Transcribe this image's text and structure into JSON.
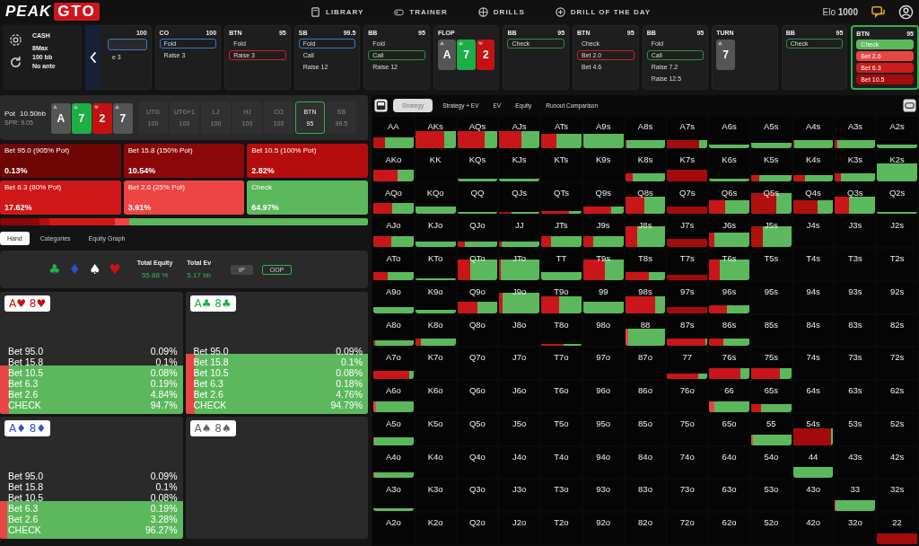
{
  "nav": {
    "logo": {
      "text": "PEAK",
      "highlight": "GTO"
    },
    "items": [
      {
        "label": "LIBRARY"
      },
      {
        "label": "TRAINER"
      },
      {
        "label": "DRILLS"
      },
      {
        "label": "DRILL OF THE DAY"
      }
    ],
    "elo": "Elo **1000**"
  },
  "settings": {
    "lines": [
      "CASH",
      "8Max",
      "100 bb",
      "No ante"
    ]
  },
  "cards": [
    {
      "kind": "player",
      "stack": "100",
      "active": false,
      "options": [
        {
          "kind": "fold",
          "selected": true
        },
        {
          "label": "e 3",
          "selected": false
        }
      ]
    },
    {
      "kind": "player",
      "position": "CO",
      "stack": "100",
      "active": false,
      "options": [
        {
          "label": "Fold",
          "kind": "fold",
          "selected": true
        },
        {
          "label": "Raise 3",
          "selected": false
        }
      ]
    },
    {
      "kind": "player",
      "position": "BTN",
      "stack": "95",
      "active": false,
      "options": [
        {
          "label": "Fold",
          "selected": false
        },
        {
          "label": "Raise 3",
          "kind": "raise",
          "selected": true
        }
      ]
    },
    {
      "kind": "player",
      "position": "SB",
      "stack": "99.5",
      "active": false,
      "options": [
        {
          "label": "Fold",
          "kind": "fold",
          "selected": true
        },
        {
          "label": "Call",
          "selected": false
        },
        {
          "label": "Raise 12",
          "selected": false
        }
      ]
    },
    {
      "kind": "player",
      "position": "BB",
      "stack": "95",
      "active": false,
      "options": [
        {
          "label": "Fold",
          "selected": false
        },
        {
          "label": "Call",
          "kind": "call",
          "selected": true
        },
        {
          "label": "Raise 12",
          "selected": false
        }
      ]
    },
    {
      "kind": "street",
      "name": "FLOP",
      "cards": [
        {
          "rank": "A",
          "kind": "spades"
        },
        {
          "rank": "7",
          "kind": "clubs"
        },
        {
          "rank": "2",
          "kind": "hearts"
        }
      ]
    },
    {
      "kind": "player",
      "position": "BB",
      "stack": "95",
      "active": false,
      "options": [
        {
          "label": "Check",
          "kind": "call",
          "selected": true
        }
      ]
    },
    {
      "kind": "player",
      "position": "BTN",
      "stack": "95",
      "active": false,
      "options": [
        {
          "label": "Check",
          "selected": false
        },
        {
          "label": "Bet 2.0",
          "kind": "raise",
          "selected": true
        },
        {
          "label": "Bet 4.6",
          "selected": false
        }
      ]
    },
    {
      "kind": "player",
      "position": "BB",
      "stack": "95",
      "active": false,
      "options": [
        {
          "label": "Fold",
          "selected": false
        },
        {
          "label": "Call",
          "kind": "call",
          "selected": true
        },
        {
          "label": "Raise 7.2",
          "selected": false
        },
        {
          "label": "Raise 12.5",
          "selected": false
        }
      ]
    },
    {
      "kind": "street",
      "name": "TURN",
      "cards": [
        {
          "rank": "7",
          "kind": "spades"
        }
      ]
    },
    {
      "kind": "player",
      "position": "BB",
      "stack": "95",
      "active": false,
      "options": [
        {
          "label": "Check",
          "kind": "call",
          "selected": true
        }
      ]
    },
    {
      "kind": "player",
      "position": "BTN",
      "stack": "95",
      "active": true,
      "options": [
        {
          "label": "Check",
          "color": "#5cb85c"
        },
        {
          "label": "Bet 2.6",
          "color": "#e84545"
        },
        {
          "label": "Bet 6.3",
          "color": "#cc1c1c"
        },
        {
          "label": "Bet 10.5",
          "color": "#a30c0c"
        }
      ]
    }
  ],
  "pot": {
    "label": "Pot",
    "value": "10.50bb",
    "spr": "SPR: 9.05",
    "cards": [
      {
        "rank": "A",
        "kind": "spades"
      },
      {
        "rank": "7",
        "kind": "clubs"
      },
      {
        "rank": "2",
        "kind": "hearts"
      },
      {
        "rank": "7",
        "kind": "spades"
      }
    ]
  },
  "seats": [
    {
      "name": "UTG",
      "stack": "100",
      "disabled": true,
      "selected": false
    },
    {
      "name": "UTG+1",
      "stack": "100",
      "disabled": true,
      "selected": false
    },
    {
      "name": "LJ",
      "stack": "100",
      "disabled": true,
      "selected": false
    },
    {
      "name": "HJ",
      "stack": "100",
      "disabled": true,
      "selected": false
    },
    {
      "name": "CO",
      "stack": "100",
      "disabled": true,
      "selected": false
    },
    {
      "name": "BTN",
      "stack": "95",
      "disabled": false,
      "selected": true
    },
    {
      "name": "SB",
      "stack": "99.5",
      "disabled": true,
      "selected": false
    }
  ],
  "actions": [
    {
      "label": "Bet 95.0 (905% Pot)",
      "value": "0.13%",
      "color": "#6e0606"
    },
    {
      "label": "Bet 15.8 (150% Pot)",
      "value": "10.54%",
      "color": "#8c0808"
    },
    {
      "label": "Bet 10.5 (100% Pot)",
      "value": "2.82%",
      "color": "#b50d0d"
    },
    {
      "label": "Bet 6.3 (80% Pot)",
      "value": "17.62%",
      "color": "#d01818"
    },
    {
      "label": "Bet 2.6 (25% Pot)",
      "value": "3.91%",
      "color": "#ef4444"
    },
    {
      "label": "Check",
      "value": "64.97%",
      "color": "#5cb85c"
    }
  ],
  "tabs": [
    {
      "label": "Hand",
      "selected": true
    },
    {
      "label": "Categories",
      "selected": false
    },
    {
      "label": "Equity Graph",
      "selected": false
    }
  ],
  "suit_filters": [
    {
      "symbol": "♣",
      "color": "#22b04a"
    },
    {
      "symbol": "♦",
      "color": "#2a4fd6"
    },
    {
      "symbol": "♠",
      "color": "#ffffff"
    },
    {
      "symbol": "♥",
      "color": "#c81414"
    }
  ],
  "totals": [
    {
      "label": "Total Equity",
      "value": "55.88 %"
    },
    {
      "label": "Total Ev",
      "value": "5.17 bb"
    }
  ],
  "players": [
    {
      "label": "IP",
      "selected": false
    },
    {
      "label": "OOP",
      "selected": true
    }
  ],
  "hands": [
    {
      "label": "A♥ 8♥",
      "color": "#c41212",
      "kind": "mid",
      "bet": {
        "color": "#e84545",
        "level": 0.05
      },
      "rows": [
        {
          "action": "Bet 95.0",
          "value": "0.09%"
        },
        {
          "action": "Bet 15.8",
          "value": "0.1%"
        },
        {
          "action": "Bet 10.5",
          "value": "0.08%"
        },
        {
          "action": "Bet 6.3",
          "value": "0.19%"
        },
        {
          "action": "Bet 2.6",
          "value": "4.84%"
        },
        {
          "action": "CHECK",
          "value": "94.7%"
        }
      ]
    },
    {
      "label": "A♣ 8♣",
      "color": "#1fae45",
      "kind": "high",
      "bet": {
        "color": "#e84545",
        "level": 0.05
      },
      "rows": [
        {
          "action": "Bet 95.0",
          "value": "0.09%"
        },
        {
          "action": "Bet 15.8",
          "value": "0.1%"
        },
        {
          "action": "Bet 10.5",
          "value": "0.08%"
        },
        {
          "action": "Bet 6.3",
          "value": "0.18%"
        },
        {
          "action": "Bet 2.6",
          "value": "4.76%"
        },
        {
          "action": "CHECK",
          "value": "94.79%"
        }
      ]
    },
    {
      "label": "A♦ 8♦",
      "color": "#2a4fd6",
      "kind": "low",
      "bet": {
        "color": "#e84545",
        "level": 0.04
      },
      "rows": [
        {
          "action": "Bet 95.0",
          "value": "0.09%"
        },
        {
          "action": "Bet 15.8",
          "value": "0.1%"
        },
        {
          "action": "Bet 10.5",
          "value": "0.08%"
        },
        {
          "action": "Bet 6.3",
          "value": "0.19%"
        },
        {
          "action": "Bet 2.6",
          "value": "3.28%"
        },
        {
          "action": "CHECK",
          "value": "96.27%"
        }
      ]
    },
    {
      "label": "A♠ 8♠",
      "color": "#666666"
    }
  ],
  "views": [
    {
      "label": "Strategy",
      "selected": true
    },
    {
      "label": "Strategy + EV",
      "selected": false
    },
    {
      "label": "EV",
      "selected": false
    },
    {
      "label": "Equity",
      "selected": false
    },
    {
      "label": "Runout Comparison",
      "selected": false
    }
  ],
  "grid": [
    {
      "cells": [
        {
          "label": "AA",
          "kind": "high",
          "bet": {
            "color": "#b81212",
            "level": 0.3
          }
        },
        {
          "label": "AKs",
          "kind": "tall",
          "bet": {
            "color": "#c8161b",
            "level": 0.72
          }
        },
        {
          "label": "AQs",
          "kind": "tall",
          "bet": {
            "color": "#c8161b",
            "level": 0.68
          }
        },
        {
          "label": "AJs",
          "kind": "tall",
          "bet": {
            "color": "#c8161b",
            "level": 0.55
          }
        },
        {
          "label": "ATs",
          "kind": "big",
          "bet": {
            "color": "#c8161b",
            "level": 0.38
          }
        },
        {
          "label": "A9s",
          "kind": "big"
        },
        {
          "label": "A8s",
          "kind": "mid",
          "bet": {
            "color": "#c8161b",
            "level": 0.03
          }
        },
        {
          "label": "A7s",
          "kind": "mid",
          "bet": {
            "color": "#a30c0c",
            "level": 0.8
          }
        },
        {
          "label": "A6s",
          "kind": "slim"
        },
        {
          "label": "A5s",
          "kind": "low"
        },
        {
          "label": "A4s",
          "kind": "mid",
          "bet": {
            "color": "#c8161b",
            "level": 0.03
          }
        },
        {
          "label": "A3s",
          "kind": "mid",
          "bet": {
            "color": "#c8161b",
            "level": 0.05
          }
        },
        {
          "label": "A2s",
          "kind": "slim"
        }
      ]
    },
    {
      "cells": [
        {
          "label": "AKo",
          "kind": "high",
          "bet": {
            "color": "#c8161b",
            "level": 0.6
          }
        },
        {
          "label": "KK"
        },
        {
          "label": "KQs",
          "kind": "thin"
        },
        {
          "label": "KJs",
          "kind": "thin"
        },
        {
          "label": "KTs"
        },
        {
          "label": "K9s"
        },
        {
          "label": "K8s",
          "kind": "mid",
          "bet": {
            "color": "#c8161b",
            "level": 0.18
          }
        },
        {
          "label": "K7s",
          "kind": "high",
          "bet": {
            "color": "#a30c0c",
            "level": 1
          }
        },
        {
          "label": "K6s",
          "kind": "thin"
        },
        {
          "label": "K5s",
          "kind": "low",
          "bet": {
            "color": "#c8161b",
            "level": 0.2
          }
        },
        {
          "label": "K4s",
          "kind": "low",
          "bet": {
            "color": "#c8161b",
            "level": 0.3
          }
        },
        {
          "label": "K3s",
          "kind": "mid",
          "bet": {
            "color": "#c8161b",
            "level": 0.15
          }
        },
        {
          "label": "K2s",
          "kind": "tall"
        }
      ]
    },
    {
      "cells": [
        {
          "label": "AQo",
          "kind": "high",
          "bet": {
            "color": "#c8161b",
            "level": 0.48
          }
        },
        {
          "label": "KQo",
          "kind": "mid"
        },
        {
          "label": "QQ",
          "kind": "thin"
        },
        {
          "label": "QJs",
          "kind": "thin",
          "bet": {
            "color": "#a30c0c",
            "level": 0.3
          }
        },
        {
          "label": "QTs",
          "kind": "slim",
          "bet": {
            "color": "#c8161b",
            "level": 0.7
          }
        },
        {
          "label": "Q9s",
          "kind": "mid",
          "bet": {
            "color": "#c8161b",
            "level": 0.7
          }
        },
        {
          "label": "Q8s",
          "kind": "tall",
          "bet": {
            "color": "#c8161b",
            "level": 0.48
          }
        },
        {
          "label": "Q7s",
          "kind": "mid",
          "bet": {
            "color": "#a30c0c",
            "level": 1
          }
        },
        {
          "label": "Q6s",
          "kind": "big",
          "bet": {
            "color": "#c8161b",
            "level": 0.4
          }
        },
        {
          "label": "Q5s",
          "kind": "full",
          "bet": {
            "color": "#b01010",
            "level": 0.62
          }
        },
        {
          "label": "Q4s",
          "kind": "big",
          "bet": {
            "color": "#b01010",
            "level": 0.62
          }
        },
        {
          "label": "Q3s",
          "kind": "tall",
          "bet": {
            "color": "#c8161b",
            "level": 0.35
          }
        },
        {
          "label": "Q2s",
          "kind": "thin"
        }
      ]
    },
    {
      "cells": [
        {
          "label": "AJo",
          "kind": "high",
          "bet": {
            "color": "#c8161b",
            "level": 0.45
          }
        },
        {
          "label": "KJo",
          "kind": "low"
        },
        {
          "label": "QJo",
          "kind": "low",
          "bet": {
            "color": "#c8161b",
            "level": 0.18
          }
        },
        {
          "label": "JJ",
          "kind": "low",
          "bet": {
            "color": "#c8161b",
            "level": 0.05
          }
        },
        {
          "label": "JTs",
          "kind": "high",
          "bet": {
            "color": "#c8161b",
            "level": 0.25
          }
        },
        {
          "label": "J9s",
          "kind": "high",
          "bet": {
            "color": "#c8161b",
            "level": 0.25
          }
        },
        {
          "label": "J8s",
          "kind": "full",
          "bet": {
            "color": "#c8161b",
            "level": 0.3
          }
        },
        {
          "label": "J7s",
          "kind": "mid",
          "bet": {
            "color": "#a30c0c",
            "level": 1
          }
        },
        {
          "label": "J6s",
          "kind": "big",
          "bet": {
            "color": "#c8161b",
            "level": 0.12
          }
        },
        {
          "label": "J5s",
          "kind": "full",
          "bet": {
            "color": "#b01010",
            "level": 0.3
          }
        },
        {
          "label": "J4s"
        },
        {
          "label": "J3s"
        },
        {
          "label": "J2s"
        }
      ]
    },
    {
      "cells": [
        {
          "label": "ATo",
          "kind": "mid",
          "bet": {
            "color": "#c8161b",
            "level": 0.35
          }
        },
        {
          "label": "KTo",
          "kind": "thin"
        },
        {
          "label": "QTo",
          "kind": "full",
          "bet": {
            "color": "#c8161b",
            "level": 0.32
          }
        },
        {
          "label": "JTo",
          "kind": "full",
          "bet": {
            "color": "#c8161b",
            "level": 0.04
          }
        },
        {
          "label": "TT",
          "kind": "mid"
        },
        {
          "label": "T9s",
          "kind": "full",
          "bet": {
            "color": "#c8161b",
            "level": 0.55
          }
        },
        {
          "label": "T8s",
          "kind": "mid",
          "bet": {
            "color": "#c8161b",
            "level": 0.6
          }
        },
        {
          "label": "T7s",
          "kind": "low",
          "bet": {
            "color": "#a30c0c",
            "level": 1
          }
        },
        {
          "label": "T6s",
          "kind": "full",
          "bet": {
            "color": "#c8161b",
            "level": 0.26
          }
        },
        {
          "label": "T5s"
        },
        {
          "label": "T4s"
        },
        {
          "label": "T3s"
        },
        {
          "label": "T2s"
        }
      ]
    },
    {
      "cells": [
        {
          "label": "A9o",
          "kind": "low"
        },
        {
          "label": "K9o",
          "kind": "slim"
        },
        {
          "label": "Q9o",
          "kind": "high",
          "bet": {
            "color": "#c8161b",
            "level": 0.5
          }
        },
        {
          "label": "J9o",
          "kind": "full",
          "bet": {
            "color": "#c8161b",
            "level": 0.08
          }
        },
        {
          "label": "T9o",
          "kind": "tall",
          "bet": {
            "color": "#c8161b",
            "level": 0.45
          }
        },
        {
          "label": "99",
          "kind": "high"
        },
        {
          "label": "98s",
          "kind": "tall",
          "bet": {
            "color": "#c8161b",
            "level": 0.75
          }
        },
        {
          "label": "97s",
          "kind": "low",
          "bet": {
            "color": "#a30c0c",
            "level": 1
          }
        },
        {
          "label": "96s",
          "kind": "mid",
          "bet": {
            "color": "#c8161b",
            "level": 0.45
          }
        },
        {
          "label": "95s"
        },
        {
          "label": "94s"
        },
        {
          "label": "93s"
        },
        {
          "label": "92s"
        }
      ]
    },
    {
      "cells": [
        {
          "label": "A8o",
          "kind": "low",
          "bet": {
            "color": "#c8161b",
            "level": 0.05
          }
        },
        {
          "label": "K8o",
          "kind": "mid",
          "bet": {
            "color": "#c8161b",
            "level": 0.15
          }
        },
        {
          "label": "Q8o"
        },
        {
          "label": "J8o"
        },
        {
          "label": "T8o",
          "kind": "thin",
          "bet": {
            "color": "#c8161b",
            "level": 0.55
          }
        },
        {
          "label": "98o"
        },
        {
          "label": "88",
          "kind": "tall",
          "bet": {
            "color": "#e84545",
            "level": 0.07
          }
        },
        {
          "label": "87s",
          "kind": "mid",
          "bet": {
            "color": "#c8161b",
            "level": 0.95
          }
        },
        {
          "label": "86s",
          "kind": "mid",
          "bet": {
            "color": "#c8161b",
            "level": 0.35
          }
        },
        {
          "label": "85s"
        },
        {
          "label": "84s"
        },
        {
          "label": "83s"
        },
        {
          "label": "82s"
        }
      ]
    },
    {
      "cells": [
        {
          "label": "A7o",
          "kind": "mid",
          "bet": {
            "color": "#c8161b",
            "level": 0.9
          }
        },
        {
          "label": "K7o"
        },
        {
          "label": "Q7o"
        },
        {
          "label": "J7o"
        },
        {
          "label": "T7o"
        },
        {
          "label": "97o"
        },
        {
          "label": "87o"
        },
        {
          "label": "77",
          "kind": "low",
          "bet": {
            "color": "#c8161b",
            "level": 0.77
          }
        },
        {
          "label": "76s",
          "kind": "high",
          "bet": {
            "color": "#c8161b",
            "level": 0.78
          }
        },
        {
          "label": "75s",
          "kind": "high",
          "bet": {
            "color": "#c8161b",
            "level": 0.72
          }
        },
        {
          "label": "74s"
        },
        {
          "label": "73s"
        },
        {
          "label": "72s"
        }
      ]
    },
    {
      "cells": [
        {
          "label": "A6o",
          "kind": "high",
          "bet": {
            "color": "#e84545",
            "level": 0.07
          }
        },
        {
          "label": "K6o"
        },
        {
          "label": "Q6o"
        },
        {
          "label": "J6o"
        },
        {
          "label": "T6o"
        },
        {
          "label": "96o"
        },
        {
          "label": "86o"
        },
        {
          "label": "76o"
        },
        {
          "label": "66",
          "kind": "high",
          "bet": {
            "color": "#e84545",
            "level": 0.12
          }
        },
        {
          "label": "65s",
          "kind": "mid",
          "bet": {
            "color": "#c8161b",
            "level": 0.25
          }
        },
        {
          "label": "64s"
        },
        {
          "label": "63s"
        },
        {
          "label": "62s"
        }
      ]
    },
    {
      "cells": [
        {
          "label": "A5o",
          "kind": "mid",
          "bet": {
            "color": "#e84545",
            "level": 0.03
          }
        },
        {
          "label": "K5o"
        },
        {
          "label": "Q5o"
        },
        {
          "label": "J5o"
        },
        {
          "label": "T5o"
        },
        {
          "label": "95o"
        },
        {
          "label": "85o"
        },
        {
          "label": "75o"
        },
        {
          "label": "65o"
        },
        {
          "label": "55",
          "kind": "high",
          "bet": {
            "color": "#e84545",
            "level": 0.04
          }
        },
        {
          "label": "54s",
          "kind": "tall",
          "bet": {
            "color": "#a30c0c",
            "level": 0.95
          }
        },
        {
          "label": "53s"
        },
        {
          "label": "52s"
        }
      ]
    },
    {
      "cells": [
        {
          "label": "A4o",
          "kind": "low",
          "bet": {
            "color": "#e84545",
            "level": 0.03
          }
        },
        {
          "label": "K4o"
        },
        {
          "label": "Q4o"
        },
        {
          "label": "J4o"
        },
        {
          "label": "T4o"
        },
        {
          "label": "94o"
        },
        {
          "label": "84o"
        },
        {
          "label": "74o"
        },
        {
          "label": "64o"
        },
        {
          "label": "54o"
        },
        {
          "label": "44",
          "kind": "high"
        },
        {
          "label": "43s"
        },
        {
          "label": "42s"
        }
      ]
    },
    {
      "cells": [
        {
          "label": "A3o",
          "kind": "slim"
        },
        {
          "label": "K3o"
        },
        {
          "label": "Q3o"
        },
        {
          "label": "J3o"
        },
        {
          "label": "T3o"
        },
        {
          "label": "93o"
        },
        {
          "label": "83o"
        },
        {
          "label": "73o"
        },
        {
          "label": "63o"
        },
        {
          "label": "53o"
        },
        {
          "label": "43o"
        },
        {
          "label": "33",
          "kind": "high",
          "bet": {
            "color": "#e84545",
            "level": 0.02
          }
        },
        {
          "label": "32s"
        }
      ]
    },
    {
      "cells": [
        {
          "label": "A2o"
        },
        {
          "label": "K2o"
        },
        {
          "label": "Q2o"
        },
        {
          "label": "J2o"
        },
        {
          "label": "T2o"
        },
        {
          "label": "92o"
        },
        {
          "label": "82o"
        },
        {
          "label": "72o"
        },
        {
          "label": "62o"
        },
        {
          "label": "52o"
        },
        {
          "label": "42o"
        },
        {
          "label": "32o"
        },
        {
          "label": "22",
          "kind": "high",
          "bet": {
            "color": "#a30c0c",
            "level": 1
          }
        }
      ]
    }
  ]
}
